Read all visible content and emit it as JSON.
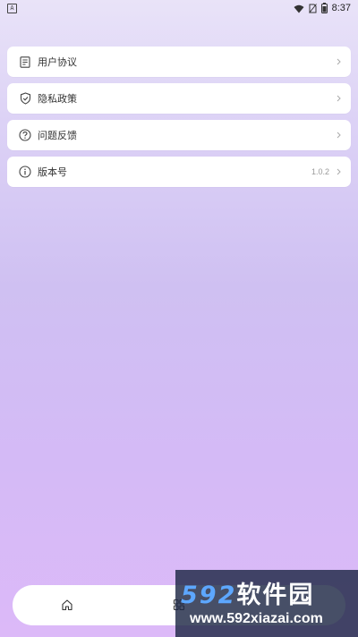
{
  "status_bar": {
    "left_indicator": "A",
    "time": "8:37",
    "icons": [
      "wifi-icon",
      "sim-disabled-icon",
      "battery-icon"
    ]
  },
  "menu": {
    "items": [
      {
        "label": "用户协议",
        "icon": "document-icon",
        "value": ""
      },
      {
        "label": "隐私政策",
        "icon": "shield-check-icon",
        "value": ""
      },
      {
        "label": "问题反馈",
        "icon": "question-circle-icon",
        "value": ""
      },
      {
        "label": "版本号",
        "icon": "info-circle-icon",
        "value": "1.0.2"
      }
    ]
  },
  "bottom_nav": {
    "items": [
      {
        "icon": "home-icon"
      },
      {
        "icon": "apps-grid-icon"
      }
    ]
  },
  "watermark": {
    "brand_number": "592",
    "brand_text": "软件园",
    "url": "www.592xiazai.com"
  },
  "colors": {
    "bg_top": "#e9e3f8",
    "bg_bottom": "#dcb9f8",
    "card": "#ffffff",
    "muted_text": "#999999",
    "watermark_accent": "#5da7ff"
  }
}
